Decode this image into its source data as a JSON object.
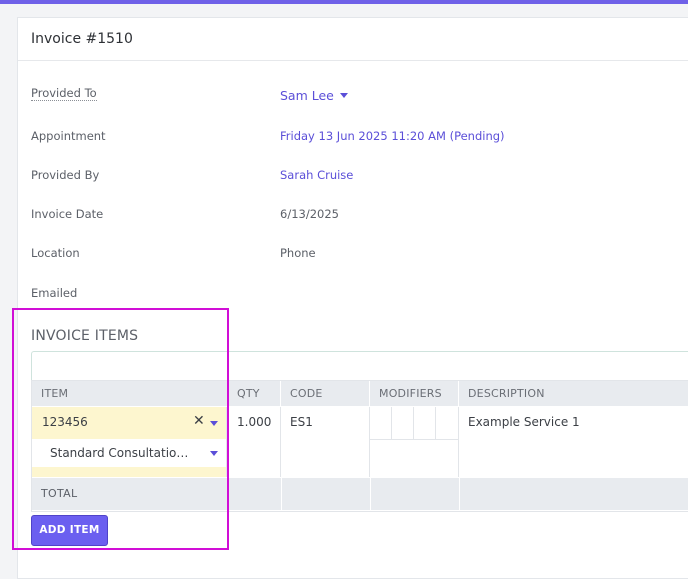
{
  "invoice": {
    "title": "Invoice #1510"
  },
  "fields": {
    "provided_to_label": "Provided To",
    "provided_to_value": "Sam Lee",
    "appointment_label": "Appointment",
    "appointment_value": "Friday 13 Jun 2025 11:20 AM (Pending)",
    "provided_by_label": "Provided By",
    "provided_by_value": "Sarah Cruise",
    "invoice_date_label": "Invoice Date",
    "invoice_date_value": "6/13/2025",
    "location_label": "Location",
    "location_value": "Phone",
    "emailed_label": "Emailed"
  },
  "items": {
    "section_title": "INVOICE ITEMS",
    "search_placeholder": "",
    "columns": {
      "item": "ITEM",
      "qty": "QTY",
      "code": "CODE",
      "modifiers": "MODIFIERS",
      "description": "DESCRIPTION"
    },
    "rows": [
      {
        "item_code": "123456",
        "item_name": "Standard Consultation",
        "item_name_display": "Standard Consultatio…",
        "qty": "1.000",
        "code": "ES1",
        "description": "Example Service 1"
      }
    ],
    "total_label": "TOTAL",
    "add_button": "ADD ITEM"
  },
  "colors": {
    "accent": "#6b5ff0",
    "link": "#5b4fd8",
    "highlight": "#d10ed6",
    "item_bg": "#fdf6cf"
  },
  "icons": {
    "clear": "close-icon",
    "dropdown": "chevron-down-icon"
  }
}
